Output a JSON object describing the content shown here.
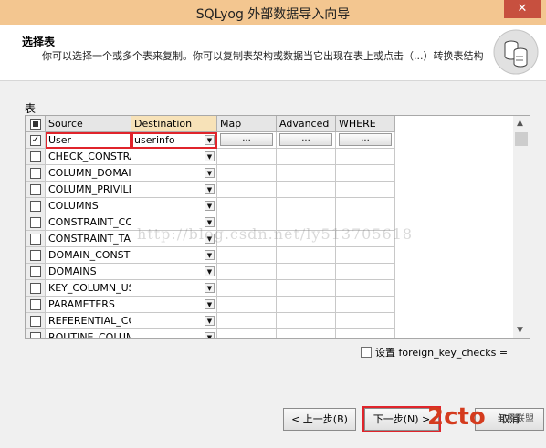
{
  "window": {
    "title": "SQLyog 外部数据导入向导",
    "close_label": "✕"
  },
  "header": {
    "title": "选择表",
    "description": "你可以选择一个或多个表来复制。你可以复制表架构或数据当它出现在表上或点击（...）转换表结构"
  },
  "section_label": "表",
  "grid": {
    "columns": [
      "Source",
      "Destination",
      "Map",
      "Advanced",
      "WHERE"
    ],
    "rows": [
      {
        "source": "User",
        "destination": "userinfo",
        "checked": true,
        "map": "...",
        "advanced": "...",
        "where": "..."
      },
      {
        "source": "CHECK_CONSTRAINTS",
        "destination": "",
        "checked": false
      },
      {
        "source": "COLUMN_DOMAIN_USAGE",
        "destination": "",
        "checked": false
      },
      {
        "source": "COLUMN_PRIVILEGES",
        "destination": "",
        "checked": false
      },
      {
        "source": "COLUMNS",
        "destination": "",
        "checked": false
      },
      {
        "source": "CONSTRAINT_COLUMN_USAGE",
        "destination": "",
        "checked": false
      },
      {
        "source": "CONSTRAINT_TABLE_USAGE",
        "destination": "",
        "checked": false
      },
      {
        "source": "DOMAIN_CONSTRAINTS",
        "destination": "",
        "checked": false
      },
      {
        "source": "DOMAINS",
        "destination": "",
        "checked": false
      },
      {
        "source": "KEY_COLUMN_USAGE",
        "destination": "",
        "checked": false
      },
      {
        "source": "PARAMETERS",
        "destination": "",
        "checked": false
      },
      {
        "source": "REFERENTIAL_CONSTRAINTS",
        "destination": "",
        "checked": false
      },
      {
        "source": "ROUTINE_COLUMNS",
        "destination": "",
        "checked": false
      }
    ]
  },
  "options": {
    "fk_checks_label": "设置 foreign_key_checks =",
    "fk_checked": false
  },
  "buttons": {
    "prev": "< 上一步(B)",
    "next": "下一步(N) >",
    "cancel": "取消"
  },
  "watermark": "http://blog.csdn.net/ly513705618",
  "brand": {
    "logo": "2cto",
    "sub": "红黑联盟"
  }
}
